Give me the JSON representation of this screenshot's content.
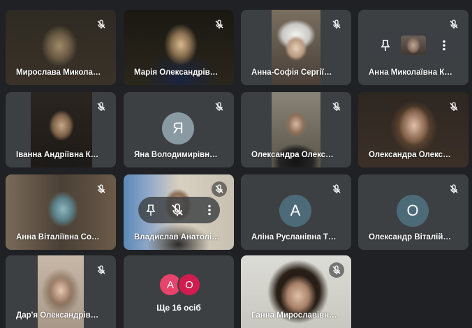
{
  "participants": [
    {
      "name": "Мирослава Микола…"
    },
    {
      "name": "Марія Олександрів…"
    },
    {
      "name": "Анна-Софія Сергії…"
    },
    {
      "name": "Анна Миколаївна К…"
    },
    {
      "name": "Іванна Андріївна К…"
    },
    {
      "name": "Яна Володимирівн…",
      "initial": "Я"
    },
    {
      "name": "Олександра Олекс…"
    },
    {
      "name": "Олександра Олекс…"
    },
    {
      "name": "Анна Віталіївна Со…"
    },
    {
      "name": "Владислав Анатолі…"
    },
    {
      "name": "Аліна Русланівна Т…",
      "initial": "А"
    },
    {
      "name": "Олександр Віталій…",
      "initial": "О"
    },
    {
      "name": "Дар'я Олександрів…"
    },
    {
      "name": "Ганна Мирославівн…"
    }
  ],
  "others": {
    "initials": [
      "А",
      "О"
    ],
    "colors": [
      "#e8436b",
      "#d01c4f"
    ],
    "label": "Ще 16 осіб"
  },
  "icons": [
    "mic-off-icon",
    "pin-icon",
    "more-vert-icon"
  ],
  "colors": {
    "background": "#202124",
    "tile": "#3c4043"
  }
}
